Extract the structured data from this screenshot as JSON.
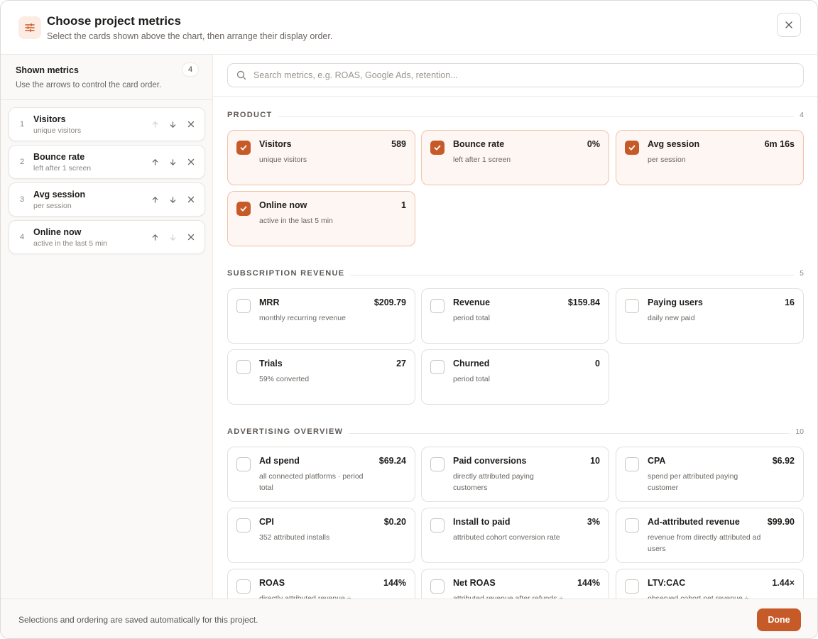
{
  "header": {
    "title": "Choose project metrics",
    "subtitle": "Select the cards shown above the chart, then arrange their display order.",
    "icon": "sliders-icon",
    "close_icon": "close-icon"
  },
  "sidebar": {
    "title": "Shown metrics",
    "subtitle": "Use the arrows to control the card order.",
    "count": "4",
    "items": [
      {
        "num": "1",
        "name": "Visitors",
        "desc": "unique visitors",
        "up_enabled": false,
        "down_enabled": true
      },
      {
        "num": "2",
        "name": "Bounce rate",
        "desc": "left after 1 screen",
        "up_enabled": true,
        "down_enabled": true
      },
      {
        "num": "3",
        "name": "Avg session",
        "desc": "per session",
        "up_enabled": true,
        "down_enabled": true
      },
      {
        "num": "4",
        "name": "Online now",
        "desc": "active in the last 5 min",
        "up_enabled": true,
        "down_enabled": false
      }
    ]
  },
  "search": {
    "placeholder": "Search metrics, e.g. ROAS, Google Ads, retention...",
    "value": ""
  },
  "sections": [
    {
      "title": "PRODUCT",
      "count": "4",
      "cards": [
        {
          "name": "Visitors",
          "value": "589",
          "desc": "unique visitors",
          "checked": true
        },
        {
          "name": "Bounce rate",
          "value": "0%",
          "desc": "left after 1 screen",
          "checked": true
        },
        {
          "name": "Avg session",
          "value": "6m 16s",
          "desc": "per session",
          "checked": true
        },
        {
          "name": "Online now",
          "value": "1",
          "desc": "active in the last 5 min",
          "checked": true
        }
      ]
    },
    {
      "title": "SUBSCRIPTION REVENUE",
      "count": "5",
      "cards": [
        {
          "name": "MRR",
          "value": "$209.79",
          "desc": "monthly recurring revenue",
          "checked": false
        },
        {
          "name": "Revenue",
          "value": "$159.84",
          "desc": "period total",
          "checked": false
        },
        {
          "name": "Paying users",
          "value": "16",
          "desc": "daily new paid",
          "checked": false
        },
        {
          "name": "Trials",
          "value": "27",
          "desc": "59% converted",
          "checked": false
        },
        {
          "name": "Churned",
          "value": "0",
          "desc": "period total",
          "checked": false
        }
      ]
    },
    {
      "title": "ADVERTISING OVERVIEW",
      "count": "10",
      "cards": [
        {
          "name": "Ad spend",
          "value": "$69.24",
          "desc": "all connected platforms · period total",
          "checked": false
        },
        {
          "name": "Paid conversions",
          "value": "10",
          "desc": "directly attributed paying customers",
          "checked": false
        },
        {
          "name": "CPA",
          "value": "$6.92",
          "desc": "spend per attributed paying customer",
          "checked": false
        },
        {
          "name": "CPI",
          "value": "$0.20",
          "desc": "352 attributed installs",
          "checked": false
        },
        {
          "name": "Install to paid",
          "value": "3%",
          "desc": "attributed cohort conversion rate",
          "checked": false
        },
        {
          "name": "Ad-attributed revenue",
          "value": "$99.90",
          "desc": "revenue from directly attributed ad users",
          "checked": false
        },
        {
          "name": "ROAS",
          "value": "144%",
          "desc": "directly attributed revenue ÷ spend",
          "checked": false
        },
        {
          "name": "Net ROAS",
          "value": "144%",
          "desc": "attributed revenue after refunds ÷ spend",
          "checked": false
        },
        {
          "name": "LTV:CAC",
          "value": "1.44×",
          "desc": "observed cohort net revenue ÷ acquisition spend",
          "checked": false
        }
      ]
    }
  ],
  "footer": {
    "text": "Selections and ordering are saved automatically for this project.",
    "done_label": "Done"
  },
  "colors": {
    "accent": "#c65a28",
    "selected_bg": "#fdf6f2",
    "selected_border": "#f2c2a8"
  }
}
